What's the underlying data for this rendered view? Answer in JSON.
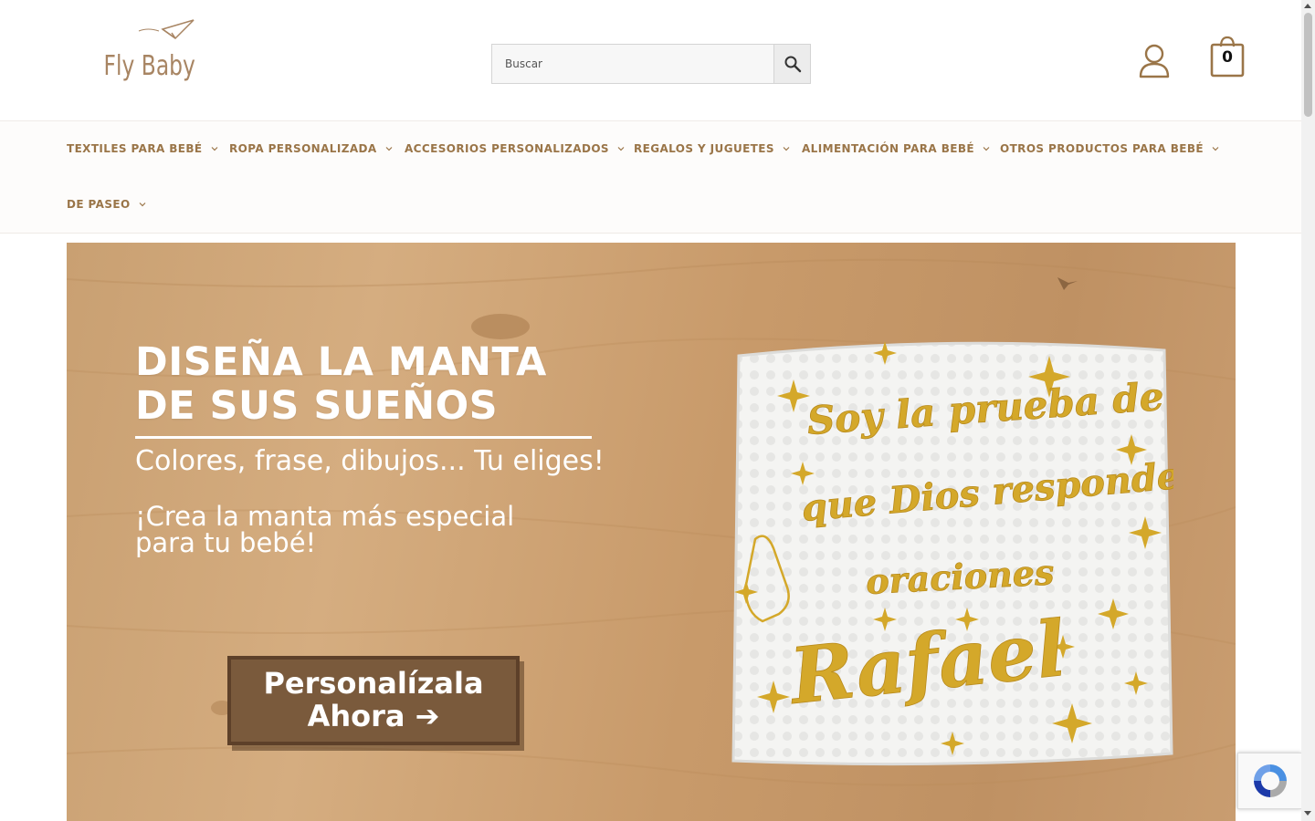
{
  "header": {
    "logo_text": "Fly Baby",
    "search_placeholder": "Buscar",
    "cart_count": "0"
  },
  "nav": {
    "items": [
      {
        "label": "TEXTILES PARA BEBÉ"
      },
      {
        "label": "ROPA PERSONALIZADA"
      },
      {
        "label": "ACCESORIOS PERSONALIZADOS"
      },
      {
        "label": "REGALOS Y JUGUETES"
      },
      {
        "label": "ALIMENTACIÓN PARA BEBÉ"
      },
      {
        "label": "OTROS PRODUCTOS PARA BEBÉ"
      },
      {
        "label": "DE PASEO"
      }
    ]
  },
  "hero": {
    "title_line1": "DISEÑA LA MANTA",
    "title_line2": "DE SUS SUEÑOS",
    "subtitle": "Colores, frase, dibujos... Tu eliges!",
    "tagline_line1": "¡Crea la manta más especial",
    "tagline_line2": "para tu bebé!",
    "cta_line1": "Personalízala",
    "cta_line2": "Ahora ➔",
    "blanket_text_line1": "Soy la prueba de",
    "blanket_text_line2": "que Dios responde",
    "blanket_text_line3": "oraciones",
    "blanket_name": "Rafael"
  },
  "colors": {
    "brand": "#9a7548",
    "logo": "#a88563",
    "gold_embroidery": "#d4a82a",
    "wood": "#c9a072"
  },
  "icons": {
    "search": "search-icon",
    "account": "user-icon",
    "cart": "shopping-bag-icon",
    "nav_dropdown": "chevron-down-icon",
    "recaptcha": "recaptcha-icon"
  }
}
